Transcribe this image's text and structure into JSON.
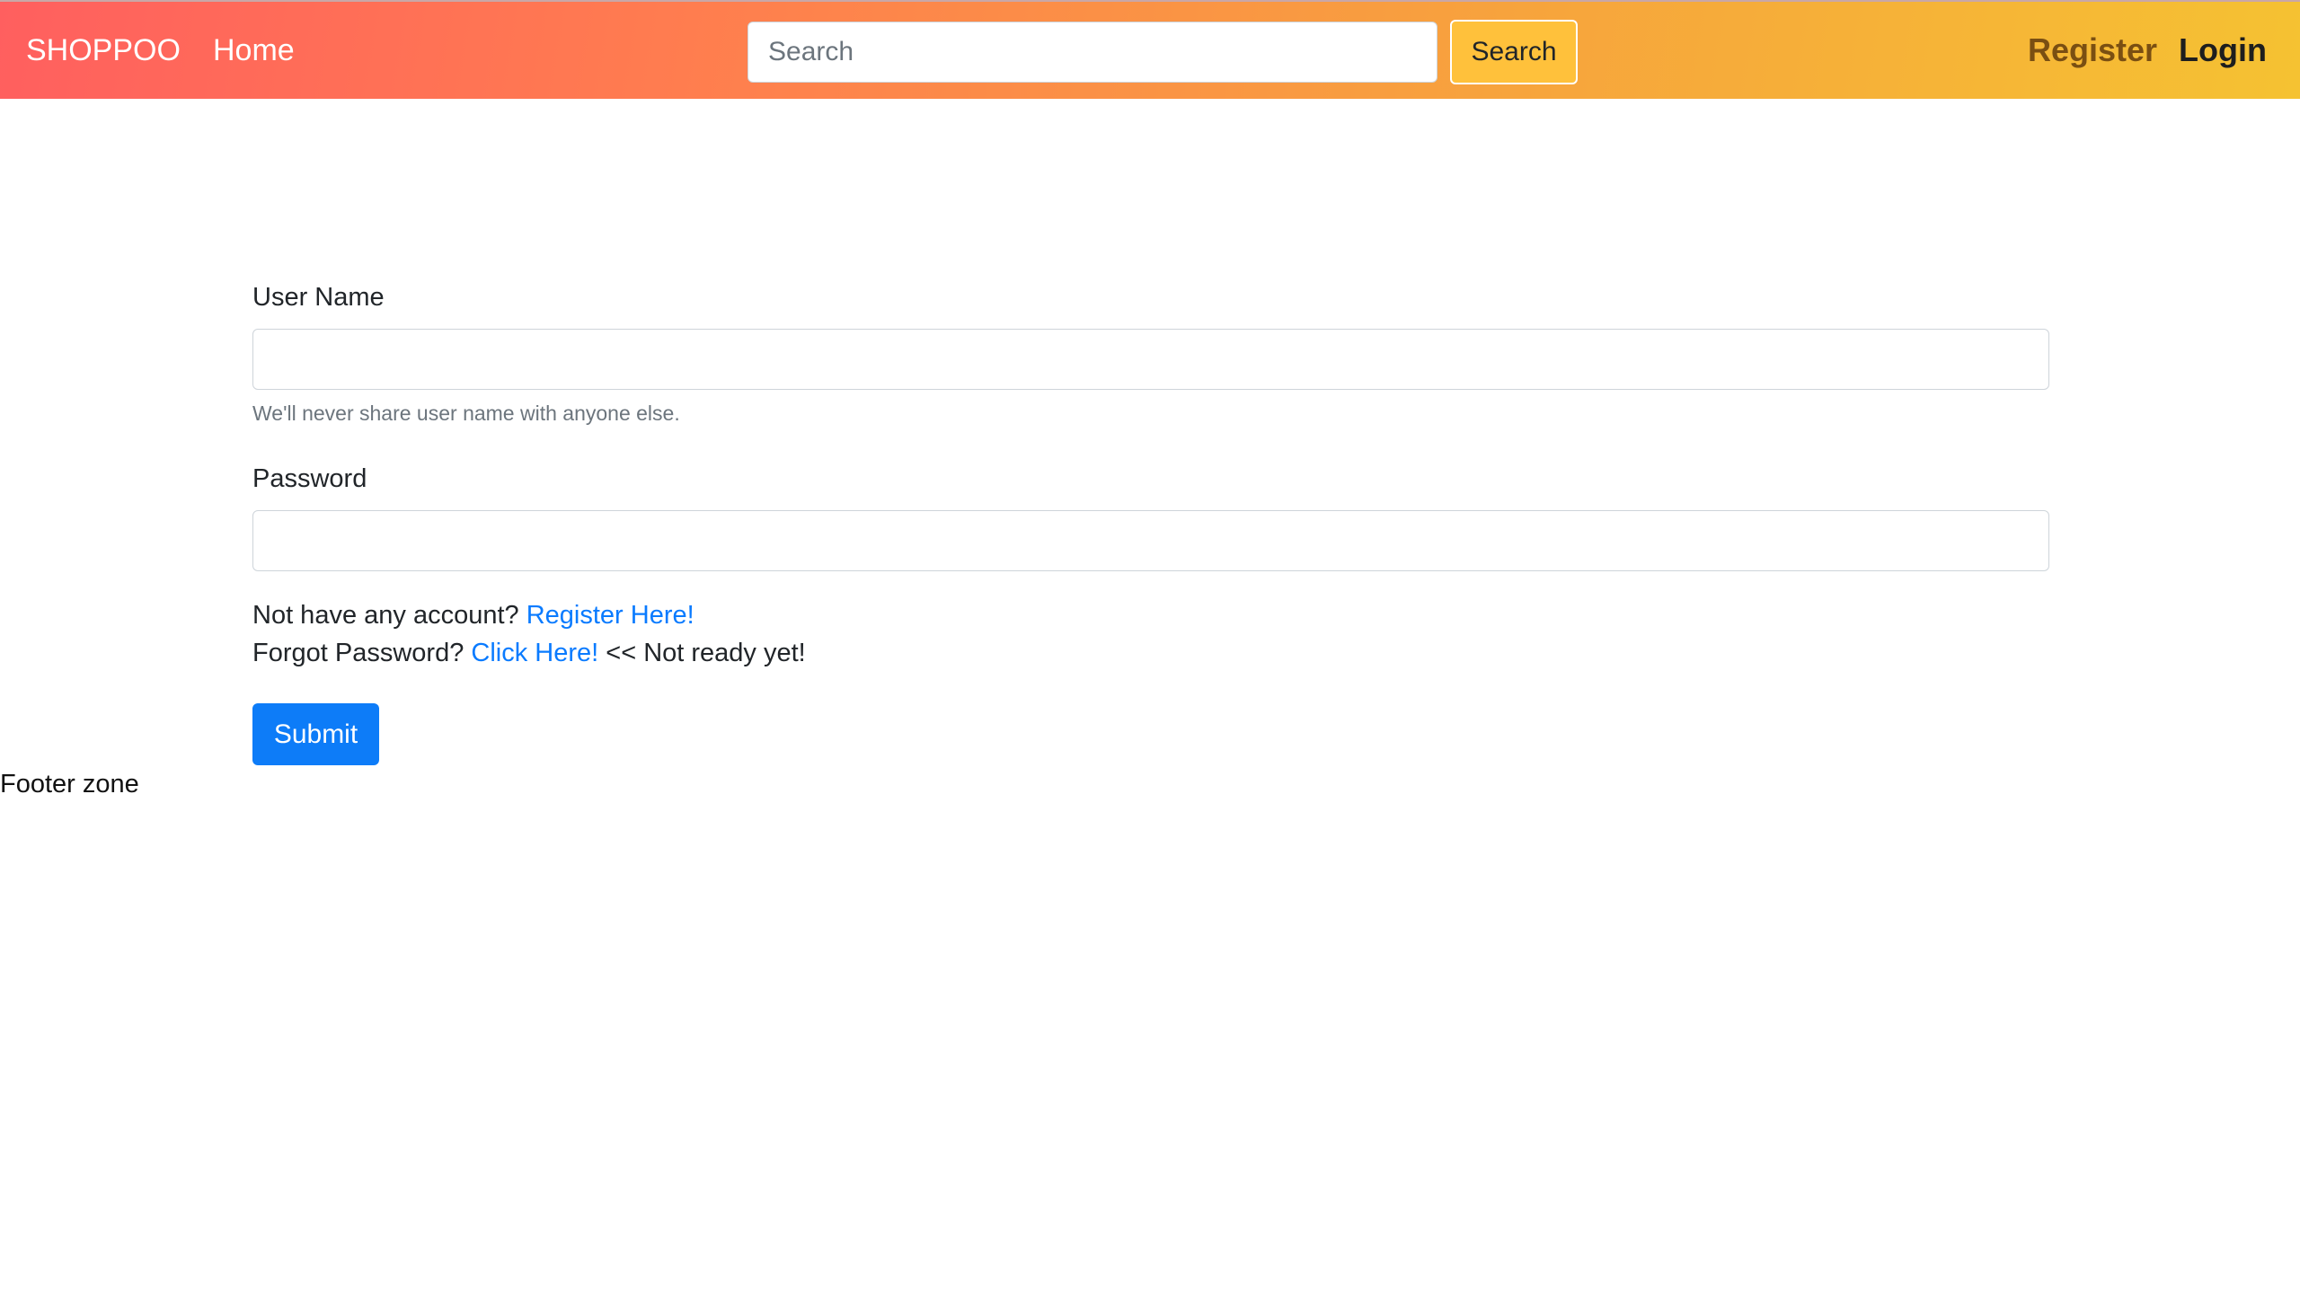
{
  "navbar": {
    "brand": "SHOPPOO",
    "home": "Home",
    "search_placeholder": "Search",
    "search_value": "",
    "search_button": "Search",
    "register": "Register",
    "login": "Login"
  },
  "form": {
    "username_label": "User Name",
    "username_value": "",
    "username_help": "We'll never share user name with anyone else.",
    "password_label": "Password",
    "password_value": "",
    "no_account_text": "Not have any account? ",
    "register_link": "Register Here!",
    "forgot_text": "Forgot Password? ",
    "forgot_link": "Click Here!",
    "forgot_note": " << Not ready yet!",
    "submit": "Submit"
  },
  "footer": {
    "text": "Footer zone"
  },
  "colors": {
    "navbar_gradient_start": "#ff5f5f",
    "navbar_gradient_end": "#f5c232",
    "search_button_bg": "#ffc13b",
    "link": "#0a7bff",
    "submit_bg": "#0d7cf8"
  }
}
